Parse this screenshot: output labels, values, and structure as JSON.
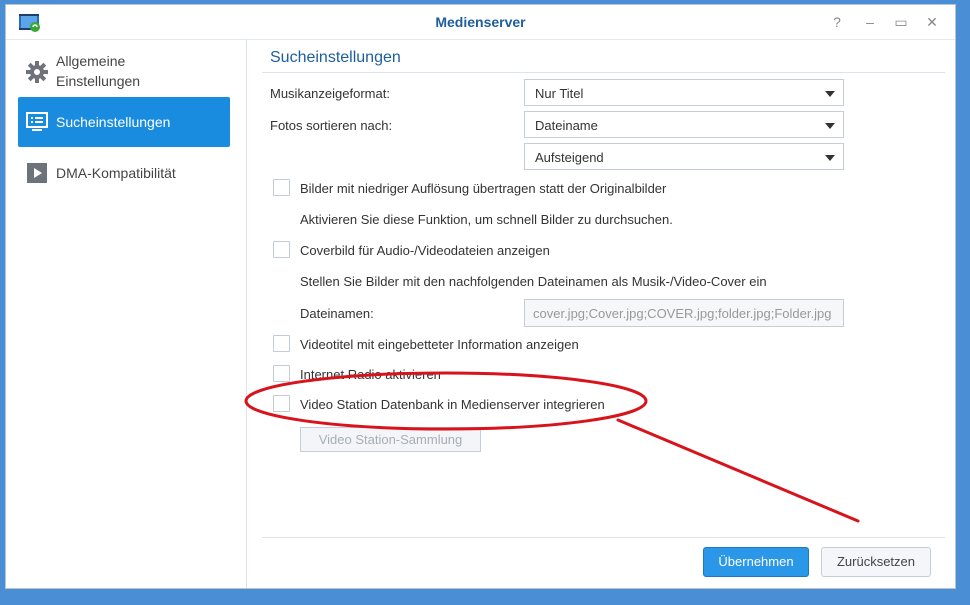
{
  "window": {
    "title": "Medienserver",
    "help_glyph": "?",
    "minimize_glyph": "–",
    "maximize_glyph": "▭",
    "close_glyph": "✕"
  },
  "sidebar": {
    "items": [
      {
        "label_line1": "Allgemeine",
        "label_line2": "Einstellungen",
        "icon": "gear-icon"
      },
      {
        "label": "Sucheinstellungen",
        "icon": "monitor-list-icon",
        "active": true
      },
      {
        "label": "DMA-Kompatibilität",
        "icon": "play-icon"
      }
    ]
  },
  "main": {
    "section_title": "Sucheinstellungen",
    "music_format": {
      "label": "Musikanzeigeformat:",
      "value": "Nur Titel"
    },
    "photo_sort": {
      "label": "Fotos sortieren nach:",
      "value": "Dateiname",
      "order": "Aufsteigend"
    },
    "low_res": {
      "label": "Bilder mit niedriger Auflösung übertragen statt der Originalbilder",
      "desc": "Aktivieren Sie diese Funktion, um schnell Bilder zu durchsuchen."
    },
    "cover": {
      "label": "Coverbild für Audio-/Videodateien anzeigen",
      "desc": "Stellen Sie Bilder mit den nachfolgenden Dateinamen als Musik-/Video-Cover ein",
      "filenames_label": "Dateinamen:",
      "filenames_value": "cover.jpg;Cover.jpg;COVER.jpg;folder.jpg;Folder.jpg"
    },
    "video_title": {
      "label": "Videotitel mit eingebetteter Information anzeigen"
    },
    "internet_radio": {
      "label": "Internet Radio aktivieren"
    },
    "video_station": {
      "label": "Video Station Datenbank in Medienserver integrieren"
    },
    "video_collection_button": "Video Station-Sammlung"
  },
  "footer": {
    "apply": "Übernehmen",
    "reset": "Zurücksetzen"
  },
  "colors": {
    "accent": "#1a8ce0",
    "annotation": "#d8131b"
  }
}
